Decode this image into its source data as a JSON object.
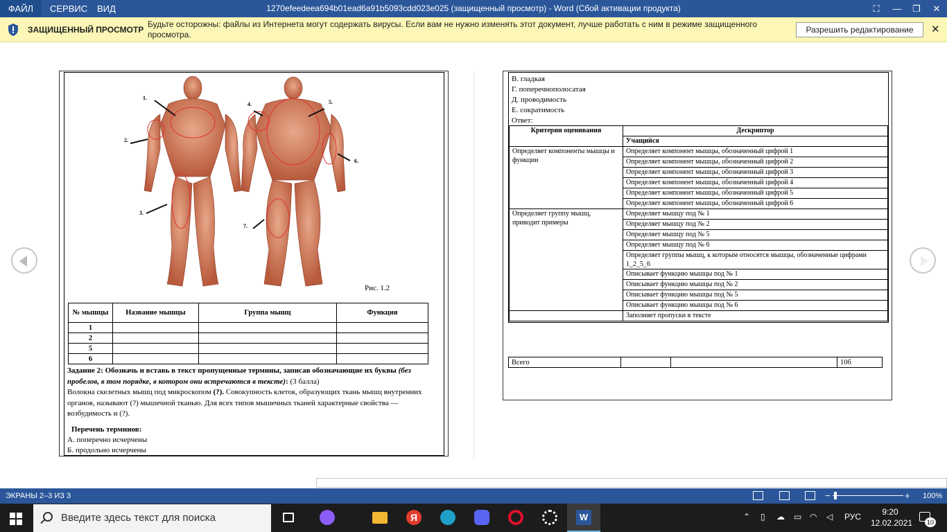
{
  "ribbon": {
    "file": "ФАЙЛ",
    "service": "СЕРВИС",
    "view": "ВИД",
    "title": "1270efeedeea694b01ead6a91b5093cdd023e025 (защищенный просмотр) - Word (Сбой активации продукта)"
  },
  "protected": {
    "title": "ЗАЩИЩЕННЫЙ ПРОСМОТР",
    "message": "Будьте осторожны: файлы из Интернета могут содержать вирусы. Если вам не нужно изменять этот документ, лучше работать с ним в режиме защищенного просмотра.",
    "enable_button": "Разрешить редактирование"
  },
  "page1": {
    "figure": {
      "caption": "Рис. 1.2",
      "labels": [
        "1.",
        "2.",
        "3.",
        "4.",
        "5.",
        "6.",
        "7."
      ]
    },
    "muscle_table": {
      "headers": [
        "№ мышцы",
        "Название мышцы",
        "Группа мышц",
        "Функция"
      ],
      "rows": [
        "1",
        "2",
        "5",
        "6"
      ]
    },
    "task": {
      "bold": "Задание 2: Обозначь и вставь в текст пропущенные термины, записав обозначающие их буквы",
      "italic": "(без пробелов, в том порядке, в котором они встречаются в тексте)",
      "colon": ":",
      "score": " (3 балла)",
      "p1a": "Волокна скелетных мышц под микроскопом ",
      "p1b": "(?).",
      "p1c": " Совокупность клеток, образующих ткань мышц внутренних органов, называют (?) мышечной тканью. Для всех типов мышечных тканей характерные свойства — возбудимость и (?)."
    },
    "terms": {
      "heading": "Перечень терминов:",
      "a": "А. поперечно исчерчены",
      "b": "Б. продольно исчерчены"
    }
  },
  "page2": {
    "letters": [
      "В. гладкая",
      "Г. поперечнополосатая",
      "Д. проводимость",
      "Е. сократимость",
      "Ответ:"
    ],
    "criteria": {
      "header_criteria": "Критерии  оценивания",
      "header_descriptor": "Дескриптор",
      "student": "Учащийся",
      "group1": "Определяет  компоненты мышцы и функции",
      "group1_items": [
        "Определяет  компонент  мышцы, обозначенный  цифрой 1",
        "Определяет  компонент  мышцы, обозначенный  цифрой 2",
        "Определяет  компонент  мышцы, обозначенный  цифрой 3",
        "Определяет  компонент  мышцы, обозначенный  цифрой 4",
        "Определяет  компонент  мышцы, обозначенный  цифрой 5",
        "Определяет  компонент  мышцы, обозначенный  цифрой 6"
      ],
      "group2": "Определяет группу мышц, приводит примеры",
      "group2_items": [
        "Определяет мышцу под № 1",
        "Определяет мышцу под № 2",
        "Определяет мышцу под № 5",
        "Определяет мышцу под № 6",
        "Определяет группы мышц, к которым относятся мышцы, обозначенные цифрами 1_2_5_6",
        "Описывает функцию мышцы под  № 1",
        "Описывает функцию мышцы под  № 2",
        "Описывает функцию мышцы под  № 5",
        "Описывает функцию мышцы под № 6"
      ],
      "last_item": "Заполняет пропуски в тексте"
    },
    "total": {
      "label": "Всего",
      "value": "10б"
    }
  },
  "status": {
    "pages": "ЭКРАНЫ 2–3 ИЗ 3",
    "zoom_minus": "−",
    "zoom_plus": "+",
    "zoom": "100%"
  },
  "taskbar": {
    "search_placeholder": "Введите здесь текст для поиска",
    "lang": "РУС",
    "time": "9:20",
    "date": "12.02.2021",
    "notifications": "10"
  },
  "colors": {
    "accent": "#2b579a",
    "protected_bar": "#fcf7b6",
    "taskbar": "#1c1c1c"
  }
}
